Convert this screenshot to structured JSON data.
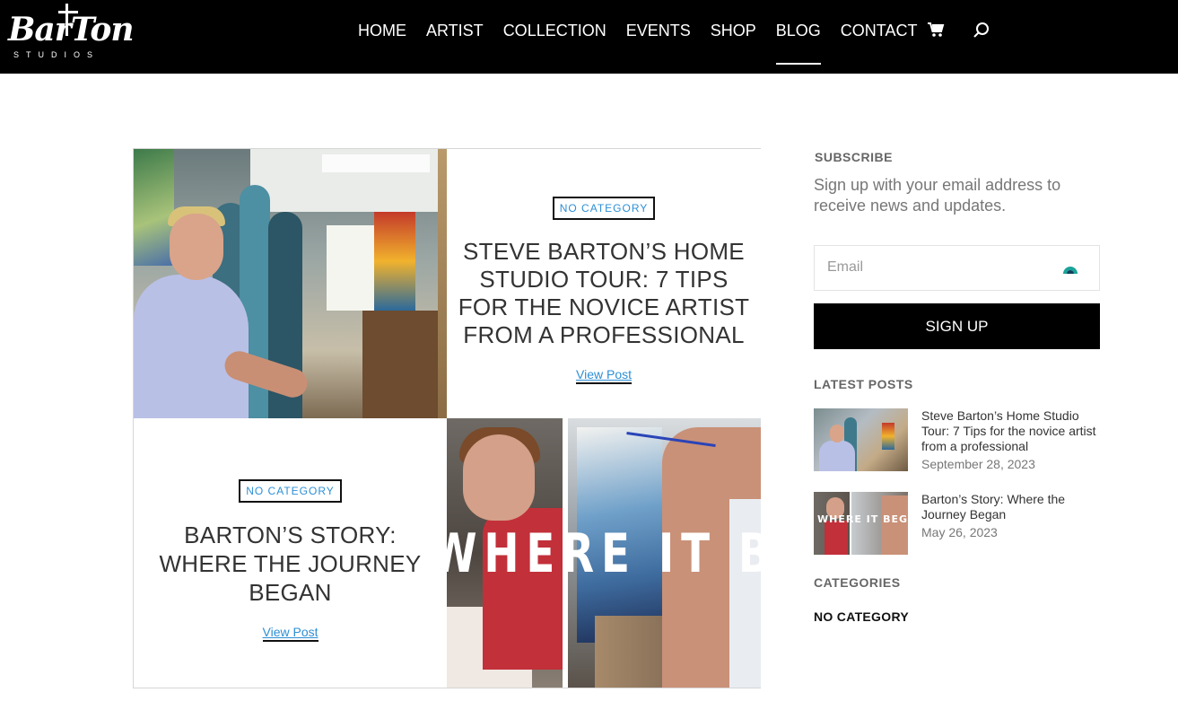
{
  "header": {
    "logo_text": "BarTon",
    "logo_subtext": "STUDIOS",
    "nav": [
      {
        "label": "HOME"
      },
      {
        "label": "ARTIST"
      },
      {
        "label": "COLLECTION"
      },
      {
        "label": "EVENTS"
      },
      {
        "label": "SHOP"
      },
      {
        "label": "BLOG",
        "active": true
      },
      {
        "label": "CONTACT"
      }
    ],
    "icons": [
      "cart-icon",
      "search-icon"
    ]
  },
  "posts": [
    {
      "category": "NO CATEGORY",
      "title": "STEVE BARTON’S HOME STUDIO TOUR: 7 TIPS FOR THE NOVICE ARTIST FROM A PROFESSIONAL",
      "link": "View Post"
    },
    {
      "category": "NO CATEGORY",
      "title": "BARTON’S STORY: WHERE THE JOURNEY BEGAN",
      "link": "View Post",
      "image_text": "WHERE IT BEGAN"
    }
  ],
  "sidebar": {
    "subscribe": {
      "heading": "SUBSCRIBE",
      "text": "Sign up with your email address to receive news and updates.",
      "email_placeholder": "Email",
      "button": "SIGN UP"
    },
    "latest": {
      "heading": "LATEST POSTS",
      "items": [
        {
          "title": "Steve Barton’s Home Studio Tour: 7 Tips for the novice artist from a professional",
          "date": "September 28, 2023"
        },
        {
          "title": "Barton’s Story: Where the Journey Began",
          "date": "May 26, 2023"
        }
      ]
    },
    "categories": {
      "heading": "CATEGORIES",
      "items": [
        "NO CATEGORY"
      ]
    }
  },
  "colors": {
    "header_bg": "#000000",
    "link_blue": "#2d8fd5",
    "button_bg": "#000000"
  }
}
